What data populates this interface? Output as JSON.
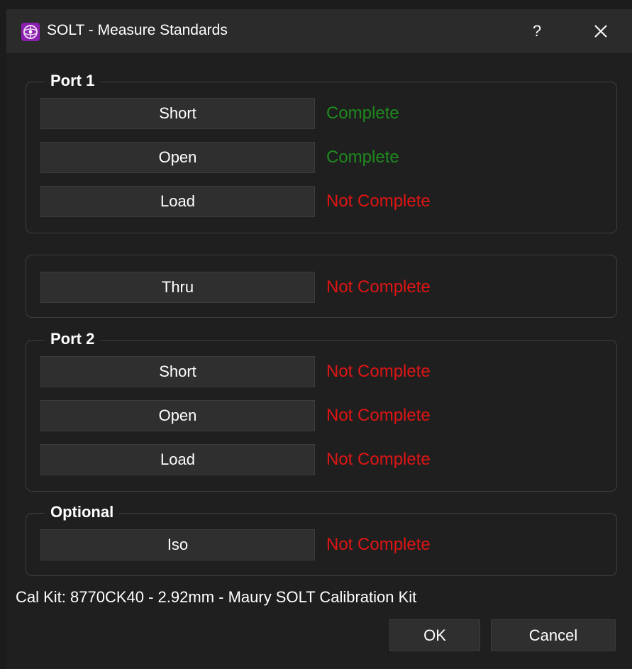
{
  "window": {
    "title": "SOLT - Measure Standards",
    "help_label": "?",
    "icons": {
      "app": "app-logo-icon",
      "close": "close-icon"
    }
  },
  "port1": {
    "title": "Port 1",
    "short": {
      "label": "Short",
      "status": "Complete"
    },
    "open": {
      "label": "Open",
      "status": "Complete"
    },
    "load": {
      "label": "Load",
      "status": "Not Complete"
    }
  },
  "thru": {
    "label": "Thru",
    "status": "Not Complete"
  },
  "port2": {
    "title": "Port 2",
    "short": {
      "label": "Short",
      "status": "Not Complete"
    },
    "open": {
      "label": "Open",
      "status": "Not Complete"
    },
    "load": {
      "label": "Load",
      "status": "Not Complete"
    }
  },
  "optional": {
    "title": "Optional",
    "iso": {
      "label": "Iso",
      "status": "Not Complete"
    }
  },
  "cal_kit": "Cal Kit: 8770CK40 - 2.92mm - Maury SOLT Calibration Kit",
  "buttons": {
    "ok": "OK",
    "cancel": "Cancel"
  },
  "colors": {
    "complete": "#1e8a1e",
    "not_complete": "#e01515",
    "background": "#1f1f1f",
    "titlebar": "#2b2b2b",
    "button": "#2f2f2f",
    "icon_brand": "#8d1fb0"
  }
}
